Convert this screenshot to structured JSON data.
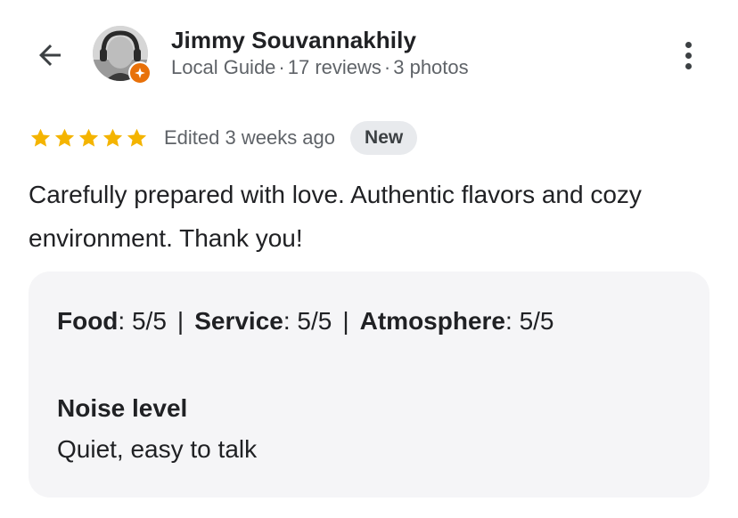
{
  "reviewer": {
    "name": "Jimmy Souvannakhily",
    "guide_label": "Local Guide",
    "reviews": "17 reviews",
    "photos": "3 photos",
    "separator": "·"
  },
  "review": {
    "rating": 5,
    "max_rating": 5,
    "edited": "Edited 3 weeks ago",
    "badge": "New",
    "text": "Carefully prepared with love. Authentic flavors and cozy environment. Thank you!"
  },
  "details": {
    "food_label": "Food",
    "food_value": "5/5",
    "service_label": "Service",
    "service_value": "5/5",
    "atmosphere_label": "Atmosphere",
    "atmosphere_value": "5/5",
    "divider": "|",
    "noise_label": "Noise level",
    "noise_value": "Quiet, easy to talk"
  },
  "colors": {
    "star": "#f4b400",
    "badge_bg": "#e8eaed",
    "card_bg": "#f5f5f7",
    "guide_badge": "#e8710a"
  },
  "icons": {
    "back": "arrow-left-icon",
    "more": "more-vertical-icon",
    "star": "star-icon",
    "guide": "local-guide-badge-icon"
  }
}
